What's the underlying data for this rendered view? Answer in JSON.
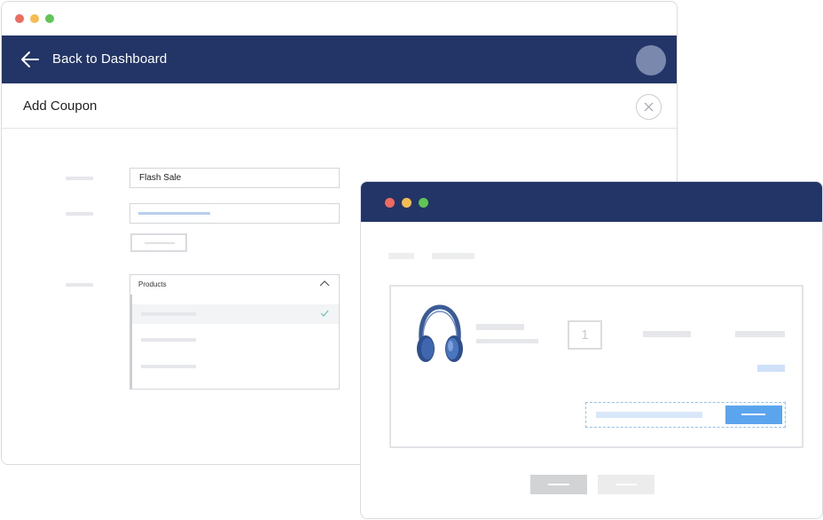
{
  "window_controls": {
    "close_color": "#ee6b5f",
    "minimize_color": "#f5bd4f",
    "maximize_color": "#61c554"
  },
  "dashboard_window": {
    "appbar": {
      "back_label": "Back to Dashboard",
      "background": "#233567"
    },
    "page": {
      "title": "Add Coupon"
    },
    "form": {
      "coupon_name_value": "Flash Sale",
      "applies_to_dropdown": {
        "selected_label": "Products"
      }
    }
  },
  "cart_window": {
    "titlebar_color": "#233567",
    "product": {
      "icon": "headphones-image",
      "quantity": "1"
    },
    "apply_button_color": "#5ba4ee"
  }
}
